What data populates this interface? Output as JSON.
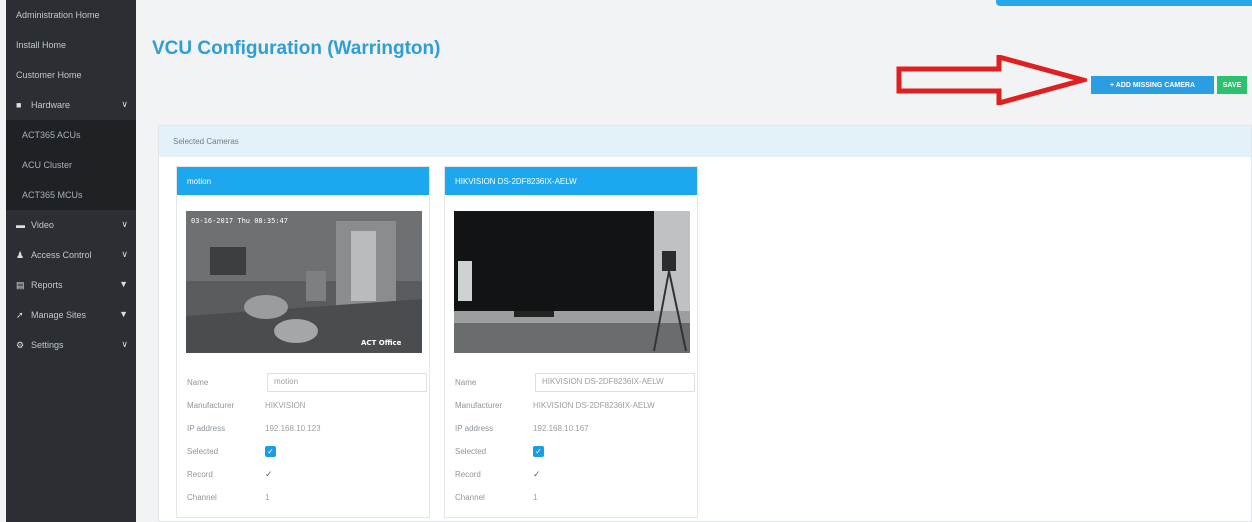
{
  "sidebar": {
    "items": [
      {
        "label": "Administration Home"
      },
      {
        "label": "Install Home"
      },
      {
        "label": "Customer Home"
      },
      {
        "label": "Hardware",
        "icon": "server-icon"
      },
      {
        "label": "ACT365 ACUs"
      },
      {
        "label": "ACU Cluster"
      },
      {
        "label": "ACT365 MCUs"
      },
      {
        "label": "Video",
        "icon": "camera-icon"
      },
      {
        "label": "Access Control",
        "icon": "user-icon"
      },
      {
        "label": "Reports",
        "icon": "report-icon"
      },
      {
        "label": "Manage Sites",
        "icon": "wrench-icon"
      },
      {
        "label": "Settings",
        "icon": "gear-icon"
      }
    ]
  },
  "header": {
    "title": "VCU Configuration (Warrington)"
  },
  "toolbar": {
    "add_camera_label": "+ ADD MISSING CAMERA",
    "save_label": "SAVE"
  },
  "panel": {
    "title": "Selected Cameras"
  },
  "cameras": [
    {
      "header": "motion",
      "name_label": "Name",
      "name_value": "motion",
      "manufacturer_label": "Manufacturer",
      "manufacturer_value": "HIKVISION",
      "ip_label": "IP address",
      "ip_value": "192.168.10.123",
      "selected_label": "Selected",
      "record_label": "Record",
      "channel_label": "Channel",
      "channel_value": "1",
      "overlay_timestamp": "03-16-2017 Thu 08:35:47",
      "overlay_caption": "ACT Office"
    },
    {
      "header": "HIKVISION DS-2DF8236IX-AELW",
      "name_label": "Name",
      "name_value": "HIKVISION DS-2DF8236IX-AELW",
      "manufacturer_label": "Manufacturer",
      "manufacturer_value": "HIKVISION DS-2DF8236IX-AELW",
      "ip_label": "IP address",
      "ip_value": "192.168.10.167",
      "selected_label": "Selected",
      "record_label": "Record",
      "channel_label": "Channel",
      "channel_value": "1"
    }
  ],
  "colors": {
    "accent": "#1ca7ee",
    "save": "#2cc26d",
    "sidebar": "#2b2f33",
    "arrow": "#e02020"
  }
}
